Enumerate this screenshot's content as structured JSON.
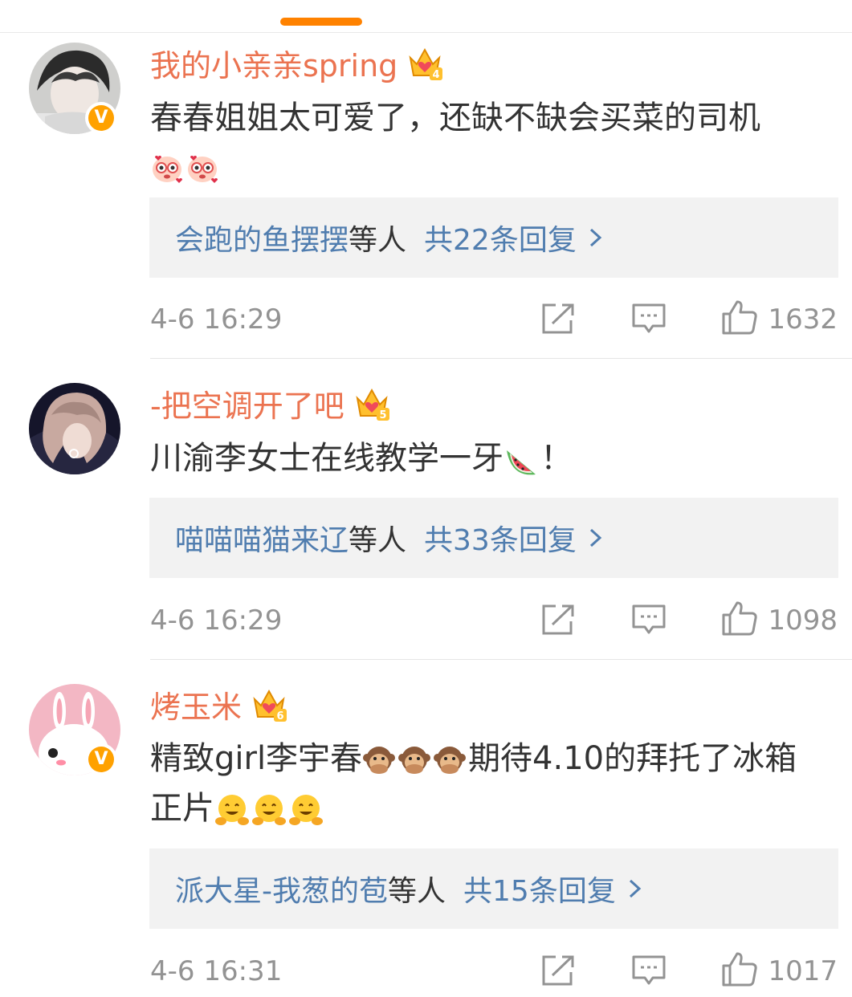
{
  "colors": {
    "accent": "#ff8200",
    "username": "#eb7350",
    "link": "#507daf",
    "meta": "#939393",
    "reply_bg": "#f2f2f2",
    "badge": "#ffa100"
  },
  "comments": [
    {
      "username": "我的小亲亲spring",
      "verified": true,
      "crown_level": "4",
      "text_line1": "春春姐姐太可爱了，还缺不缺会买菜的司机",
      "text_line2": "",
      "emojis": [
        "smitten-emoji",
        "smitten-emoji"
      ],
      "reply_users": "会跑的鱼摆摆",
      "reply_mid": "等人",
      "reply_total": "共22条回复",
      "time": "4-6 16:29",
      "likes": "1632"
    },
    {
      "username": "-把空调开了吧",
      "verified": false,
      "crown_level": "5",
      "text_before": "川渝李女士在线教学一牙",
      "text_after": "！",
      "emojis": [
        "watermelon-emoji"
      ],
      "reply_users": "喵喵喵猫来辽",
      "reply_mid": "等人",
      "reply_total": "共33条回复",
      "time": "4-6 16:29",
      "likes": "1098"
    },
    {
      "username": "烤玉米",
      "verified": true,
      "crown_level": "6",
      "text_before": "精致girl李宇春",
      "text_after": "期待4.10的拜托了冰箱",
      "text_line2": "正片",
      "emojis": [
        "speak-no-evil-monkey-emoji",
        "hugging-face-emoji"
      ],
      "reply_users": "派大星-我葱的苞",
      "reply_mid": "等人",
      "reply_total": "共15条回复",
      "time": "4-6 16:31",
      "likes": "1017"
    }
  ]
}
